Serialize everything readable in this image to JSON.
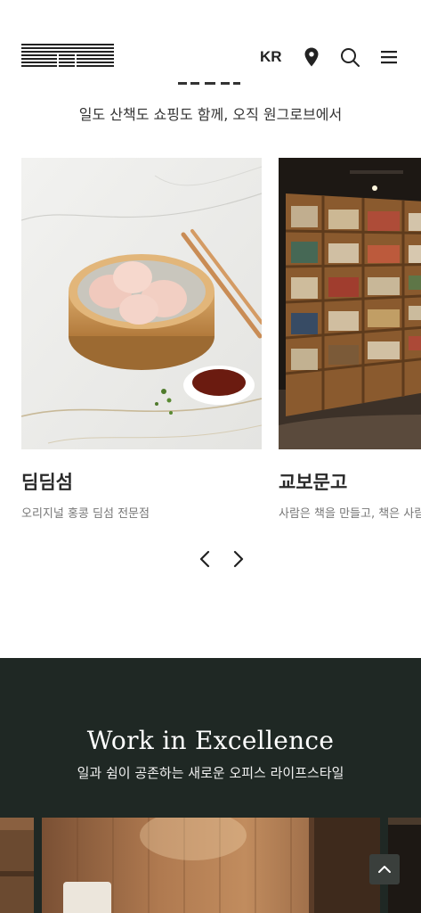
{
  "header": {
    "lang_label": "KR",
    "icons": [
      "location-pin-icon",
      "search-icon",
      "hamburger-menu-icon"
    ]
  },
  "shops_section": {
    "subtitle": "일도 산책도 쇼핑도 함께, 오직 원그로브에서",
    "cards": [
      {
        "title": "딤딤섬",
        "desc": "오리지널 홍콩 딤섬 전문점"
      },
      {
        "title": "교보문고",
        "desc": "사람은 책을 만들고, 책은 사람"
      }
    ],
    "nav": {
      "prev_icon": "chevron-left-icon",
      "next_icon": "chevron-right-icon"
    }
  },
  "work_section": {
    "title": "Work in Excellence",
    "subtitle": "일과 쉼이 공존하는 새로운 오피스 라이프스타일"
  },
  "colors": {
    "dark_green": "#1f2824",
    "text_dark": "#222222",
    "text_muted": "#777777"
  }
}
